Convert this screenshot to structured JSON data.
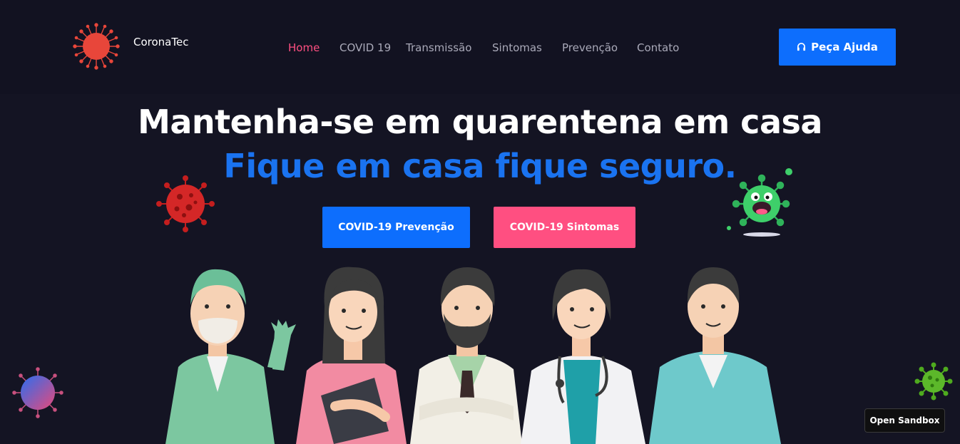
{
  "brand": {
    "name": "CoronaTec",
    "logo_icon": "virus-icon"
  },
  "nav": {
    "items": [
      {
        "label": "Home",
        "active": true
      },
      {
        "label": "COVID 19",
        "active": false
      },
      {
        "label": "Transmissão",
        "active": false
      },
      {
        "label": "Sintomas",
        "active": false
      },
      {
        "label": "Prevenção",
        "active": false
      },
      {
        "label": "Contato",
        "active": false
      }
    ]
  },
  "header_cta": {
    "label": "Peça Ajuda",
    "icon": "headset-icon"
  },
  "hero": {
    "title": "Mantenha-se em quarentena em casa",
    "subtitle": "Fique em casa fique seguro.",
    "buttons": [
      {
        "label": "COVID-19 Prevenção"
      },
      {
        "label": "COVID-19 Sintomas"
      }
    ]
  },
  "sandbox": {
    "label": "Open Sandbox"
  },
  "colors": {
    "background": "#141423",
    "header_bg": "#121221",
    "primary": "#0d6efd",
    "accent_pink": "#ff4f81",
    "subtitle_blue": "#1a73f0",
    "nav_text": "#a9a9b8"
  }
}
